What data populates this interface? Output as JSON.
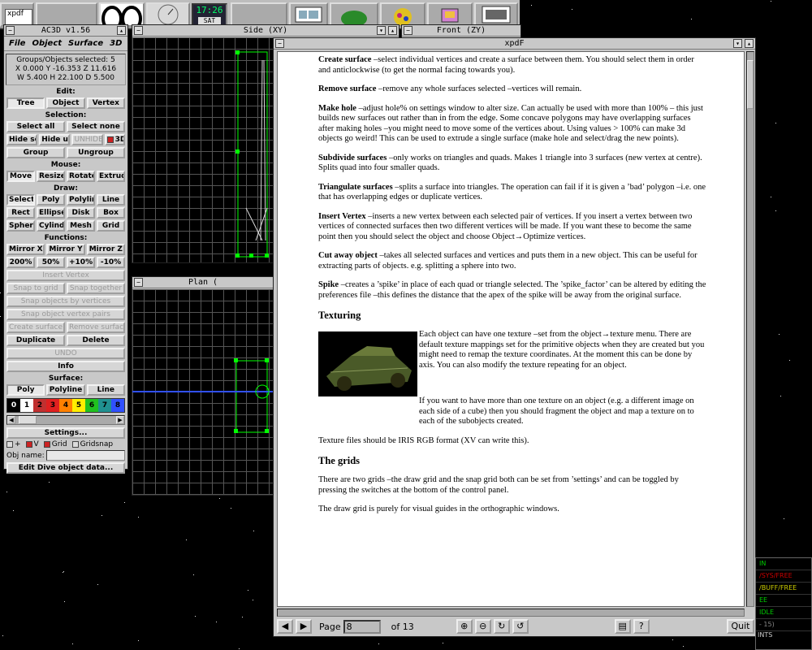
{
  "dock": {
    "xpdf_icon_label": "xpdf",
    "clock_time": "17:26",
    "clock_day": "SAT"
  },
  "ac3d": {
    "title": "AC3D v1.56",
    "menu": [
      "File",
      "Object",
      "Surface",
      "3D"
    ],
    "groups_selected": "Groups/Objects selected: 5",
    "coords": "X 0.000  Y -16.353  Z 11.616",
    "sizes": "W 5.400  H 22.100  D 5.500",
    "edit_title": "Edit:",
    "edit": [
      "Tree",
      "Object",
      "Vertex"
    ],
    "selection_title": "Selection:",
    "select_all": "Select all",
    "select_none": "Select none",
    "hide_sel": "Hide sel",
    "hide_uns": "Hide uns",
    "unhide": "UNHIDE",
    "three_d": "3D",
    "group": "Group",
    "ungroup": "Ungroup",
    "mouse_title": "Mouse:",
    "mouse": [
      "Move",
      "Resize",
      "Rotate",
      "Extrude"
    ],
    "draw_title": "Draw:",
    "draw_row1": [
      "Select",
      "Poly",
      "Polyline",
      "Line"
    ],
    "draw_row2": [
      "Rect",
      "Ellipse",
      "Disk",
      "Box"
    ],
    "draw_row3": [
      "Sphere",
      "Cylinder",
      "Mesh",
      "Grid"
    ],
    "functions_title": "Functions:",
    "mirror": [
      "Mirror X",
      "Mirror Y",
      "Mirror Z"
    ],
    "scale": [
      "200%",
      "50%",
      "+10%",
      "-10%"
    ],
    "insert_vertex": "Insert Vertex",
    "snap_to_grid": "Snap to grid",
    "snap_together": "Snap together",
    "snap_objects_by_vertices": "Snap objects by vertices",
    "snap_object_vertex_pairs": "Snap object vertex pairs",
    "create_surface": "Create surface",
    "remove_surface": "Remove surface",
    "duplicate": "Duplicate",
    "delete": "Delete",
    "undo": "UNDO",
    "info": "Info",
    "surface_title": "Surface:",
    "surface": [
      "Poly",
      "Polyline",
      "Line"
    ],
    "palette": [
      {
        "label": "0",
        "color": "#000000",
        "fg": "#ffffff"
      },
      {
        "label": "1",
        "color": "#ffffff",
        "fg": "#000000"
      },
      {
        "label": "2",
        "color": "#c03030",
        "fg": "#000000"
      },
      {
        "label": "3",
        "color": "#e02020",
        "fg": "#000000"
      },
      {
        "label": "4",
        "color": "#ff8000",
        "fg": "#000000"
      },
      {
        "label": "5",
        "color": "#ffee00",
        "fg": "#000000"
      },
      {
        "label": "6",
        "color": "#20c020",
        "fg": "#000000"
      },
      {
        "label": "7",
        "color": "#209090",
        "fg": "#000000"
      },
      {
        "label": "8",
        "color": "#3050ff",
        "fg": "#000000"
      }
    ],
    "settings": "Settings...",
    "toggle_plus": "+",
    "toggle_v": "V",
    "toggle_grid": "Grid",
    "toggle_gridsnap": "Gridsnap",
    "obj_name_label": "Obj name:",
    "edit_dive": "Edit Dive object data..."
  },
  "views": {
    "side": "Side (XY)",
    "front": "Front (ZY)",
    "plan": "Plan ("
  },
  "xpdf": {
    "title": "xpdF",
    "paragraphs": [
      {
        "term": "Create surface",
        "text": " –select individual vertices and create a surface between them. You should select them in order and anticlockwise (to get the normal facing towards you)."
      },
      {
        "term": "Remove surface",
        "text": " –remove any whole surfaces selected –vertices will remain."
      },
      {
        "term": "Make hole",
        "text": " –adjust hole% on settings window to alter size. Can actually be used with more than 100% – this just builds new surfaces out rather than in from the edge. Some concave polygons may have overlapping surfaces after making holes –you might need to move some of the vertices about. Using values > 100% can make 3d objects go weird! This can be used to extrude a single surface (make hole and select/drag the new points)."
      },
      {
        "term": "Subdivide surfaces",
        "text": " –only works on triangles and quads. Makes 1 triangle into 3 surfaces (new vertex at centre). Splits quad into four smaller quads."
      },
      {
        "term": "Triangulate surfaces",
        "text": " –splits a surface into triangles. The operation can fail if it is given a ’bad’ polygon –i.e. one that has overlapping edges or duplicate vertices."
      },
      {
        "term": "Insert Vertex",
        "text": " –inserts a new vertex between each selected pair of vertices. If you insert a vertex between two vertices of connected surfaces then two different vertices will be made. If you want these to become the same point then you should select the object and choose Object→Optimize vertices."
      },
      {
        "term": "Cut away object",
        "text": " –takes all selected surfaces and vertices and puts them in a new object. This can be useful for extracting parts of objects. e.g. splitting a sphere into two."
      },
      {
        "term": "Spike",
        "text": " –creates a ’spike’ in place of each quad or triangle selected. The ’spike_factor’ can be altered by editing the preferences file –this defines the distance that the apex of the spike will be away from the original surface."
      }
    ],
    "heading_texturing": "Texturing",
    "texturing_p1": "Each object can have one texture –set from the object→texture menu. There are default texture mappings set for the primitive objects when they are created but you might need to remap the texture coordinates. At the moment this can be done by axis. You can also modify the texture repeating for an object.",
    "texturing_p2": "If you want to have more than one texture on an object (e.g. a different image on each side of a cube) then you should fragment the object and map a texture on to each of the subobjects created.",
    "texturing_p3": "Texture files should be IRIS RGB format (XV can write this).",
    "heading_grids": "The grids",
    "grids_p1": "There are two grids –the draw grid and the snap grid both can be set from ’settings’ and can be toggled by pressing the switches at the bottom of the control panel.",
    "grids_p2": "The draw grid is purely for visual guides in the orthographic windows.",
    "page_label": "Page",
    "page_value": "8",
    "page_total": "of 13",
    "quit": "Quit",
    "help": "?"
  },
  "meters": {
    "rows": [
      "IN",
      "/SYS/FREE",
      "/BUFF/FREE",
      "EE",
      "IDLE",
      "- 15)"
    ],
    "bottom_label": "INTS"
  }
}
